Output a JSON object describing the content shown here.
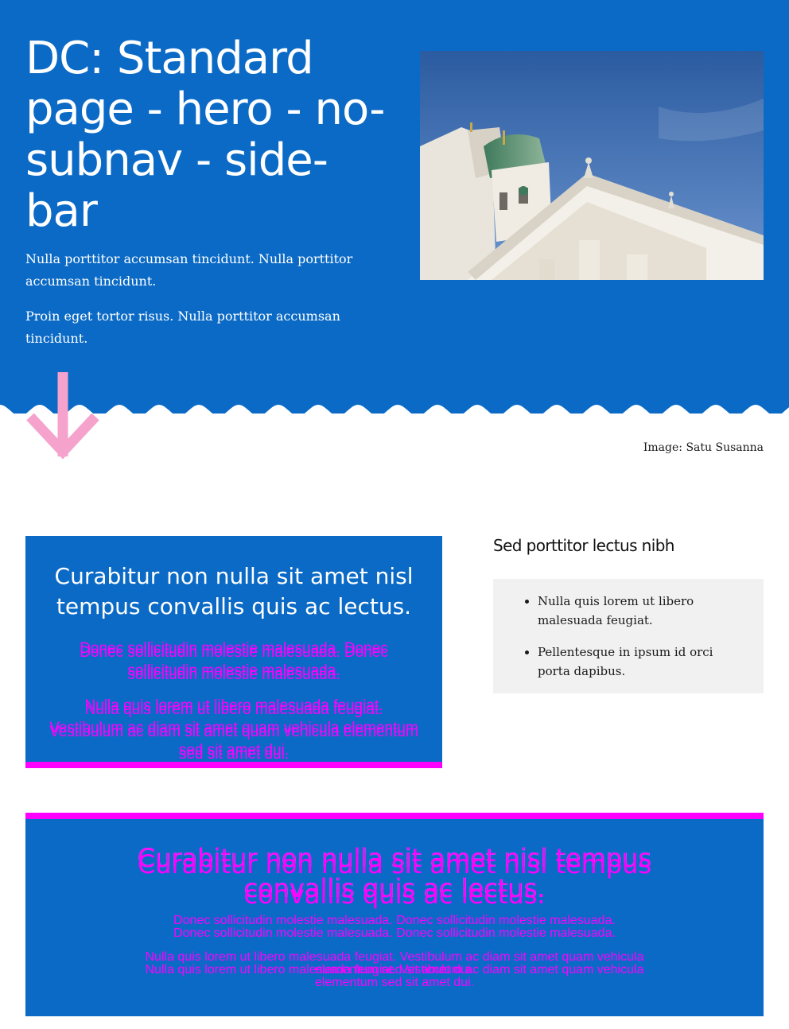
{
  "hero": {
    "title": "DC: Standard page - hero - no-subnav - side-bar",
    "paragraph_1": "Nulla porttitor accumsan tincidunt. Nulla porttitor accumsan tincidunt.",
    "paragraph_2": "Proin eget tortor risus. Nulla porttitor accumsan tincidunt.",
    "image_caption": "Image: Satu Susanna",
    "scroll_icon": "arrow-down-icon"
  },
  "card": {
    "heading": "Curabitur non nulla sit amet nisl tempus convallis quis ac lectus.",
    "text_1": "Donec sollicitudin molestie malesuada. Donec sollicitudin molestie malesuada.",
    "text_2": "Nulla quis lorem ut libero malesuada feugiat. Vestibulum ac diam sit amet quam vehicula elementum sed sit amet dui."
  },
  "sidebar": {
    "title": "Sed porttitor lectus nibh",
    "items": [
      "Nulla quis lorem ut libero malesuada feugiat.",
      "Pellentesque in ipsum id orci porta dapibus."
    ]
  },
  "band": {
    "heading": "Curabitur non nulla sit amet nisl tempus convallis quis ac lectus.",
    "text_1": "Donec sollicitudin molestie malesuada. Donec sollicitudin molestie malesuada.",
    "text_2": "Nulla quis lorem ut libero malesuada feugiat. Vestibulum ac diam sit amet quam vehicula elementum sed sit amet dui."
  },
  "colors": {
    "brand_blue": "#0a6ac6",
    "accent_magenta": "#ff00ff",
    "arrow_pink": "#f5a3cc",
    "sidebar_bg": "#f1f1f1"
  }
}
